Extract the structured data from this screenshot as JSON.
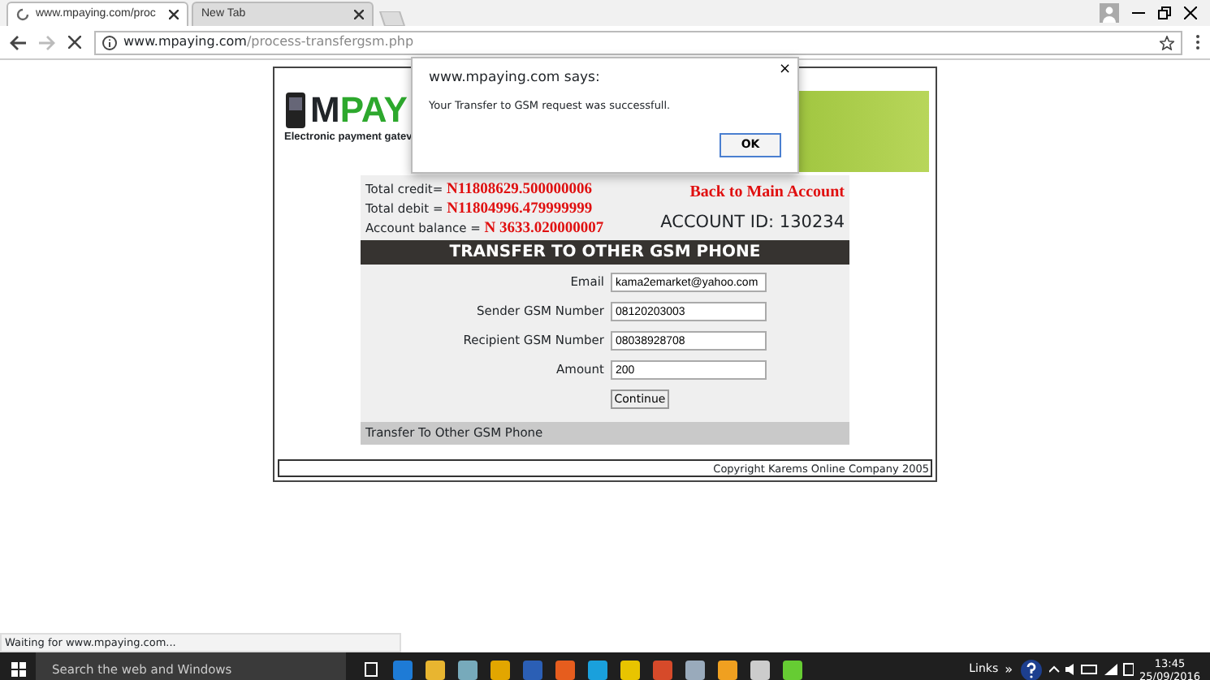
{
  "browser": {
    "tabs": [
      {
        "title": "www.mpaying.com/proc",
        "selected": true,
        "loading": true
      },
      {
        "title": "New Tab",
        "selected": false,
        "loading": false
      }
    ],
    "address": {
      "host": "www.mpaying.com",
      "path": "/process-transfergsm.php"
    },
    "status": "Waiting for www.mpaying.com..."
  },
  "page": {
    "logo": {
      "dark": "M",
      "green": "PAY"
    },
    "tagline": "Electronic payment gatev",
    "summary": [
      {
        "label": "Total credit=",
        "value": "N11808629.500000006"
      },
      {
        "label": "Total debit =",
        "value": "N11804996.479999999"
      },
      {
        "label": "Account balance =",
        "value": "N 3633.020000007"
      }
    ],
    "back_link": "Back to Main Account",
    "account_id": "ACCOUNT ID: 130234",
    "form": {
      "title": "TRANSFER TO OTHER GSM PHONE",
      "fields": [
        {
          "label": "Email",
          "value": "kama2emarket@yahoo.com"
        },
        {
          "label": "Sender GSM Number",
          "value": "08120203003"
        },
        {
          "label": "Recipient GSM Number",
          "value": "08038928708"
        },
        {
          "label": "Amount",
          "value": "200"
        }
      ],
      "button": "Continue",
      "footer": "Transfer To Other GSM Phone"
    },
    "copyright": "Copyright Karems Online Company 2005"
  },
  "dialog": {
    "title": "www.mpaying.com says:",
    "message": "Your Transfer to GSM request was successfull.",
    "ok": "OK",
    "close": "×"
  },
  "taskbar": {
    "search": {
      "placeholder": "Search the web and Windows"
    },
    "links": "Links",
    "chevron": "»",
    "time": "13:45",
    "date": "25/09/2016"
  }
}
